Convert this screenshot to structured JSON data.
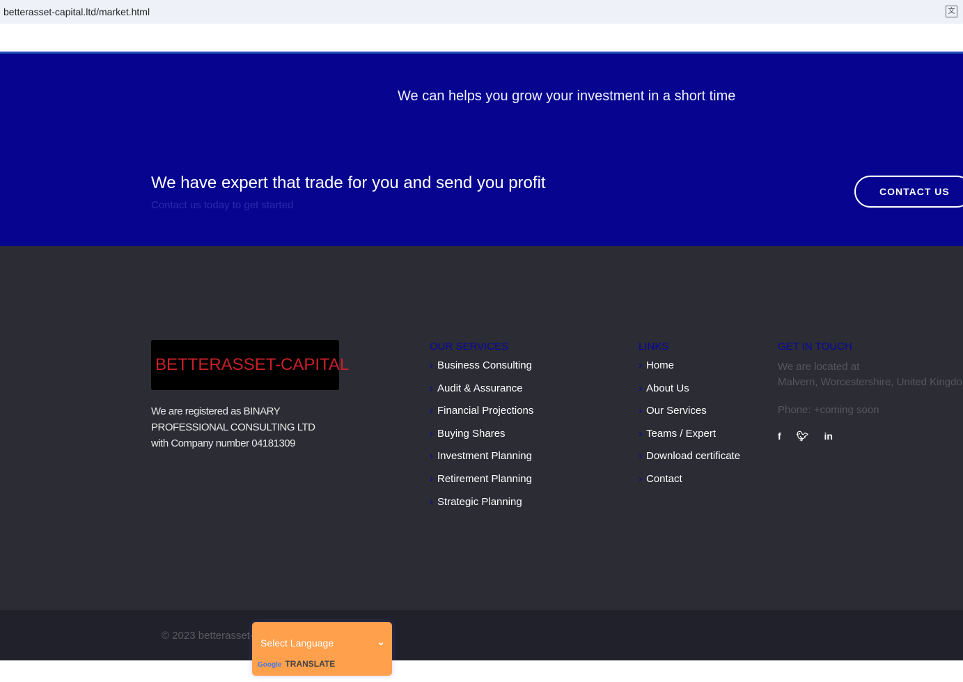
{
  "browser": {
    "url": "betterasset-capital.ltd/market.html"
  },
  "cta": {
    "tagline": "We can helps you grow your investment in a short time",
    "headline": "We have expert that trade for you and send you profit",
    "subtext": "Contact us today to get started",
    "button": "CONTACT US"
  },
  "footer": {
    "logo": "BETTERASSET-CAPITAL",
    "registration": "We are registered as BINARY PROFESSIONAL CONSULTING LTD with Company number 04181309",
    "services": {
      "title": "OUR SERVICES",
      "items": [
        "Business Consulting",
        "Audit & Assurance",
        "Financial Projections",
        "Buying Shares",
        "Investment Planning",
        "Retirement Planning",
        "Strategic Planning"
      ]
    },
    "links": {
      "title": "LINKS",
      "items": [
        "Home",
        "About Us",
        "Our Services",
        "Teams / Expert",
        "Download certificate",
        "Contact"
      ]
    },
    "contact": {
      "title": "GET IN TOUCH",
      "located": "We are located at",
      "address": "Malvern, Worcestershire, United Kingdom",
      "phone": "Phone: +coming soon",
      "social": [
        "facebook",
        "twitter",
        "linkedin"
      ]
    },
    "copyright": "© 2023 betterasset-c"
  },
  "translate": {
    "select": "Select Language",
    "google": "Google",
    "label": "TRANSLATE"
  },
  "colors": {
    "cta_bg": "#07058f",
    "footer_bg": "#2b2c34",
    "accent": "#0a06a0",
    "translate_bg": "#ffa04d"
  }
}
